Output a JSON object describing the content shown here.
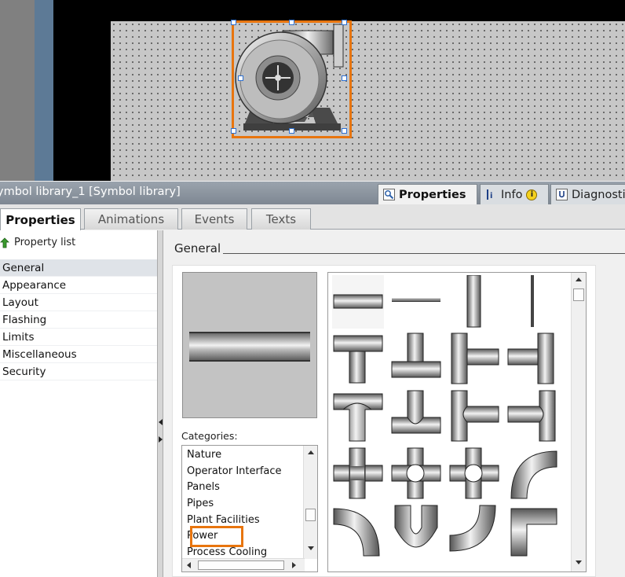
{
  "library_title": "ymbol library_1 [Symbol library]",
  "top_tabs": {
    "properties": "Properties",
    "info": "Info",
    "info_badge": "i",
    "diagnostics": "Diagnosti"
  },
  "sub_tabs": [
    "Properties",
    "Animations",
    "Events",
    "Texts"
  ],
  "property_list_label": "Property list",
  "nav_items": [
    "General",
    "Appearance",
    "Layout",
    "Flashing",
    "Limits",
    "Miscellaneous",
    "Security"
  ],
  "general_heading": "General",
  "categories_label": "Categories:",
  "categories": [
    "Nature",
    "Operator Interface",
    "Panels",
    "Pipes",
    "Plant Facilities",
    "Power",
    "Process Cooling"
  ],
  "selected_category": "Pipes",
  "colors": {
    "highlight": "#e8750e",
    "handle": "#2c6fd1"
  },
  "icons": {
    "properties_tab": "properties-icon",
    "info_tab": "info-icon",
    "diagnostics_tab": "diagnostics-icon",
    "property_list": "green-arrow-icon"
  }
}
